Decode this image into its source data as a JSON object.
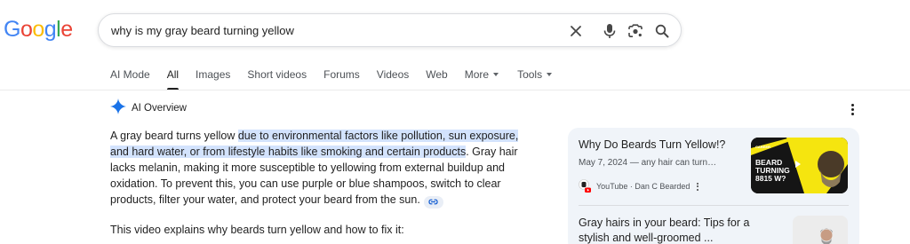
{
  "logo": {
    "text": "Google",
    "letters": [
      "G",
      "o",
      "o",
      "g",
      "l",
      "e"
    ],
    "colors": [
      "#4285f4",
      "#ea4335",
      "#fbbc05",
      "#4285f4",
      "#34a853",
      "#ea4335"
    ]
  },
  "search": {
    "query": "why is my gray beard turning yellow"
  },
  "tabs": [
    {
      "label": "AI Mode"
    },
    {
      "label": "All",
      "active": true
    },
    {
      "label": "Images"
    },
    {
      "label": "Short videos"
    },
    {
      "label": "Forums"
    },
    {
      "label": "Videos"
    },
    {
      "label": "Web"
    },
    {
      "label": "More"
    },
    {
      "label": "Tools"
    }
  ],
  "ai_overview": {
    "title": "AI Overview",
    "para_start": "A gray beard turns yellow ",
    "para_highlight": "due to environmental factors like pollution, sun exposure, and hard water, or from lifestyle habits like smoking and certain products",
    "para_rest": ". Gray hair lacks melanin, making it more susceptible to yellowing from external buildup and oxidation. To prevent this, you can use purple or blue shampoos, switch to clear products, filter your water, and protect your beard from the sun.",
    "video_intro": "This video explains why beards turn yellow and how to fix it:"
  },
  "side_panel": {
    "card1": {
      "title": "Why Do Beards Turn Yellow!?",
      "date_snippet": "May 7, 2024 — any hair can turn…",
      "source": "YouTube · Dan C Bearded",
      "thumb_text": [
        "BEARD",
        "TURNING",
        "8815 W?"
      ],
      "thumb_small": "CAREER"
    },
    "card2": {
      "title": "Gray hairs in your beard: Tips for a stylish and well-groomed ..."
    }
  },
  "colors": {
    "accent_blue": "#1a73e8",
    "highlight": "#d3e3fd",
    "panel_bg": "#f0f4f9",
    "youtube_red": "#ff0000",
    "thumb_yellow": "#f5e50f"
  }
}
